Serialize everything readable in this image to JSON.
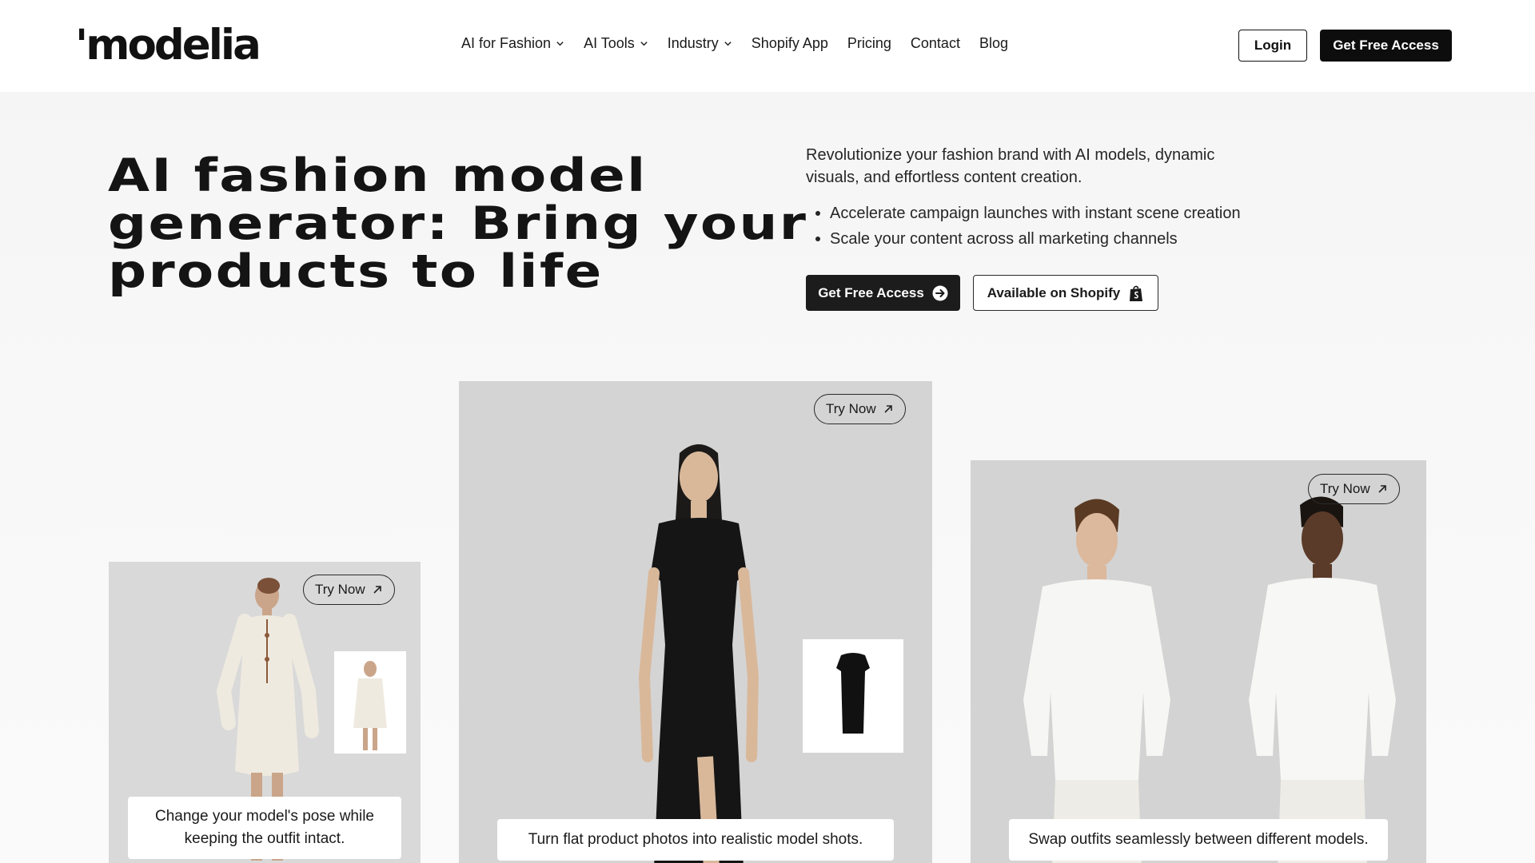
{
  "brand": {
    "logo": "'modelia"
  },
  "nav": {
    "items": [
      {
        "label": "AI for Fashion",
        "dropdown": true
      },
      {
        "label": "AI Tools",
        "dropdown": true
      },
      {
        "label": "Industry",
        "dropdown": true
      },
      {
        "label": "Shopify App",
        "dropdown": false
      },
      {
        "label": "Pricing",
        "dropdown": false
      },
      {
        "label": "Contact",
        "dropdown": false
      },
      {
        "label": "Blog",
        "dropdown": false
      }
    ],
    "login": "Login",
    "cta": "Get Free Access"
  },
  "hero": {
    "headline": "AI fashion model generator: Bring your products to life",
    "description": "Revolutionize your fashion brand with AI models, dynamic visuals, and effortless content creation.",
    "bullets": [
      "Accelerate campaign launches with instant scene creation",
      "Scale your content across all marketing channels"
    ],
    "primary_cta": "Get Free Access",
    "secondary_cta": "Available on Shopify"
  },
  "cards": [
    {
      "try_now": "Try Now",
      "caption": "Change your model's pose while keeping the outfit intact."
    },
    {
      "try_now": "Try Now",
      "caption": "Turn flat product photos into realistic model shots."
    },
    {
      "try_now": "Try Now",
      "caption": "Swap outfits seamlessly between different models."
    }
  ],
  "colors": {
    "primary": "#0d0d0d",
    "background": "#f7f7f7",
    "card": "#d5d5d5"
  },
  "icons": [
    "chevron-down-icon",
    "arrow-right-circle-icon",
    "shopify-bag-icon",
    "arrow-up-right-icon"
  ]
}
